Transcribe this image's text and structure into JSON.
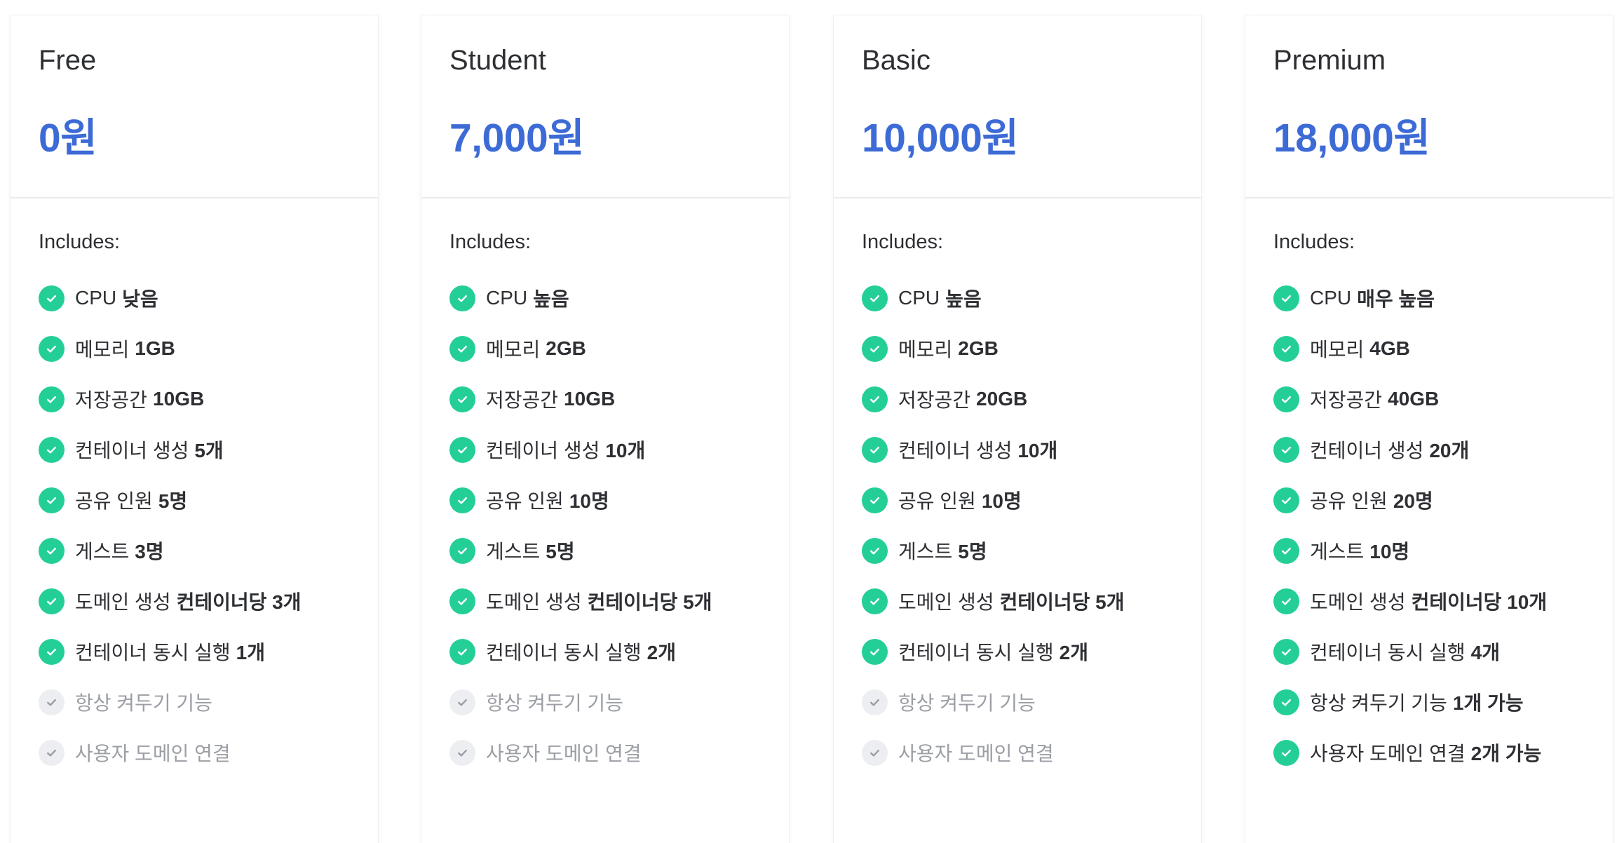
{
  "colors": {
    "price": "#3d6bd6",
    "check_on": "#24cf97",
    "check_off": "#eceef1"
  },
  "includes_label": "Includes:",
  "plans": [
    {
      "name": "Free",
      "price": "0원",
      "features": [
        {
          "label": "CPU",
          "value": "낮음",
          "enabled": true
        },
        {
          "label": "메모리",
          "value": "1GB",
          "enabled": true
        },
        {
          "label": "저장공간",
          "value": "10GB",
          "enabled": true
        },
        {
          "label": "컨테이너 생성",
          "value": "5개",
          "enabled": true
        },
        {
          "label": "공유 인원",
          "value": "5명",
          "enabled": true
        },
        {
          "label": "게스트",
          "value": "3명",
          "enabled": true
        },
        {
          "label": "도메인 생성",
          "value": "컨테이너당 3개",
          "enabled": true
        },
        {
          "label": "컨테이너 동시 실행",
          "value": "1개",
          "enabled": true
        },
        {
          "label": "항상 켜두기 기능",
          "value": "",
          "enabled": false
        },
        {
          "label": "사용자 도메인 연결",
          "value": "",
          "enabled": false
        }
      ]
    },
    {
      "name": "Student",
      "price": "7,000원",
      "features": [
        {
          "label": "CPU",
          "value": "높음",
          "enabled": true
        },
        {
          "label": "메모리",
          "value": "2GB",
          "enabled": true
        },
        {
          "label": "저장공간",
          "value": "10GB",
          "enabled": true
        },
        {
          "label": "컨테이너 생성",
          "value": "10개",
          "enabled": true
        },
        {
          "label": "공유 인원",
          "value": "10명",
          "enabled": true
        },
        {
          "label": "게스트",
          "value": "5명",
          "enabled": true
        },
        {
          "label": "도메인 생성",
          "value": "컨테이너당 5개",
          "enabled": true
        },
        {
          "label": "컨테이너 동시 실행",
          "value": "2개",
          "enabled": true
        },
        {
          "label": "항상 켜두기 기능",
          "value": "",
          "enabled": false
        },
        {
          "label": "사용자 도메인 연결",
          "value": "",
          "enabled": false
        }
      ]
    },
    {
      "name": "Basic",
      "price": "10,000원",
      "features": [
        {
          "label": "CPU",
          "value": "높음",
          "enabled": true
        },
        {
          "label": "메모리",
          "value": "2GB",
          "enabled": true
        },
        {
          "label": "저장공간",
          "value": "20GB",
          "enabled": true
        },
        {
          "label": "컨테이너 생성",
          "value": "10개",
          "enabled": true
        },
        {
          "label": "공유 인원",
          "value": "10명",
          "enabled": true
        },
        {
          "label": "게스트",
          "value": "5명",
          "enabled": true
        },
        {
          "label": "도메인 생성",
          "value": "컨테이너당 5개",
          "enabled": true
        },
        {
          "label": "컨테이너 동시 실행",
          "value": "2개",
          "enabled": true
        },
        {
          "label": "항상 켜두기 기능",
          "value": "",
          "enabled": false
        },
        {
          "label": "사용자 도메인 연결",
          "value": "",
          "enabled": false
        }
      ]
    },
    {
      "name": "Premium",
      "price": "18,000원",
      "features": [
        {
          "label": "CPU",
          "value": "매우 높음",
          "enabled": true
        },
        {
          "label": "메모리",
          "value": "4GB",
          "enabled": true
        },
        {
          "label": "저장공간",
          "value": "40GB",
          "enabled": true
        },
        {
          "label": "컨테이너 생성",
          "value": "20개",
          "enabled": true
        },
        {
          "label": "공유 인원",
          "value": "20명",
          "enabled": true
        },
        {
          "label": "게스트",
          "value": "10명",
          "enabled": true
        },
        {
          "label": "도메인 생성",
          "value": "컨테이너당 10개",
          "enabled": true
        },
        {
          "label": "컨테이너 동시 실행",
          "value": "4개",
          "enabled": true
        },
        {
          "label": "항상 켜두기 기능",
          "value": "1개 가능",
          "enabled": true
        },
        {
          "label": "사용자 도메인 연결",
          "value": "2개 가능",
          "enabled": true
        }
      ]
    }
  ]
}
